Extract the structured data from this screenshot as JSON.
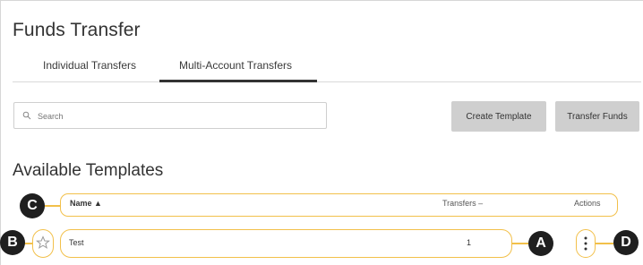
{
  "page": {
    "title": "Funds Transfer",
    "tabs": [
      {
        "label": "Individual Transfers",
        "active": false
      },
      {
        "label": "Multi-Account Transfers",
        "active": true
      }
    ]
  },
  "search": {
    "placeholder": "Search"
  },
  "toolbar": {
    "create_template_label": "Create Template",
    "transfer_funds_label": "Transfer Funds"
  },
  "section": {
    "title": "Available Templates"
  },
  "table": {
    "headers": {
      "name": "Name ▲",
      "transfers": "Transfers –",
      "actions": "Actions"
    },
    "rows": [
      {
        "name": "Test",
        "transfers": "1",
        "favorite": false
      }
    ]
  },
  "callouts": {
    "a": "A",
    "b": "B",
    "c": "C",
    "d": "D"
  },
  "colors": {
    "callout_outline": "#f2c04a",
    "button_bg": "#cfcfcf",
    "callout_badge": "#1f1f1f"
  },
  "icons": {
    "search": "search-icon",
    "star": "star-outline-icon",
    "actions": "vertical-dots-icon"
  }
}
